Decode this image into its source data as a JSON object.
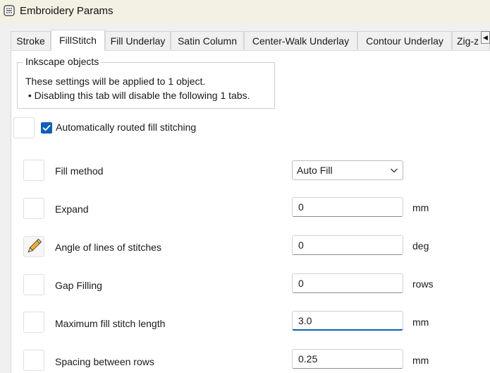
{
  "window": {
    "title": "Embroidery Params",
    "icon": "inkstitch-app-icon"
  },
  "tabs": [
    {
      "label": "Stroke",
      "active": false
    },
    {
      "label": "FillStitch",
      "active": true
    },
    {
      "label": "Fill Underlay",
      "active": false
    },
    {
      "label": "Satin Column",
      "active": false
    },
    {
      "label": "Center-Walk Underlay",
      "active": false
    },
    {
      "label": "Contour Underlay",
      "active": false
    },
    {
      "label": "Zig-z",
      "active": false
    }
  ],
  "tab_scroll": {
    "glyph": "◀",
    "icon": "scroll-left-icon"
  },
  "group": {
    "legend": "Inkscape objects",
    "line1": "These settings will be applied to 1 object.",
    "line2": " • Disabling this tab will disable the following 1 tabs."
  },
  "auto_route": {
    "label": "Automatically routed fill stitching",
    "checked": true
  },
  "params": {
    "fill_method": {
      "label": "Fill method",
      "value": "Auto Fill"
    },
    "expand": {
      "label": "Expand",
      "value": "0",
      "unit": "mm"
    },
    "angle": {
      "label": "Angle of lines of stitches",
      "value": "0",
      "unit": "deg"
    },
    "gap_filling": {
      "label": "Gap Filling",
      "value": "0",
      "unit": "rows"
    },
    "max_length": {
      "label": "Maximum fill stitch length",
      "value": "3.0",
      "unit": "mm"
    },
    "row_spacing": {
      "label": "Spacing between rows",
      "value": "0.25",
      "unit": "mm"
    }
  },
  "colors": {
    "accent": "#0f5fb8",
    "titlebar": "#f3f0e4",
    "panel": "#ffffff",
    "background": "#f0f0f0"
  }
}
